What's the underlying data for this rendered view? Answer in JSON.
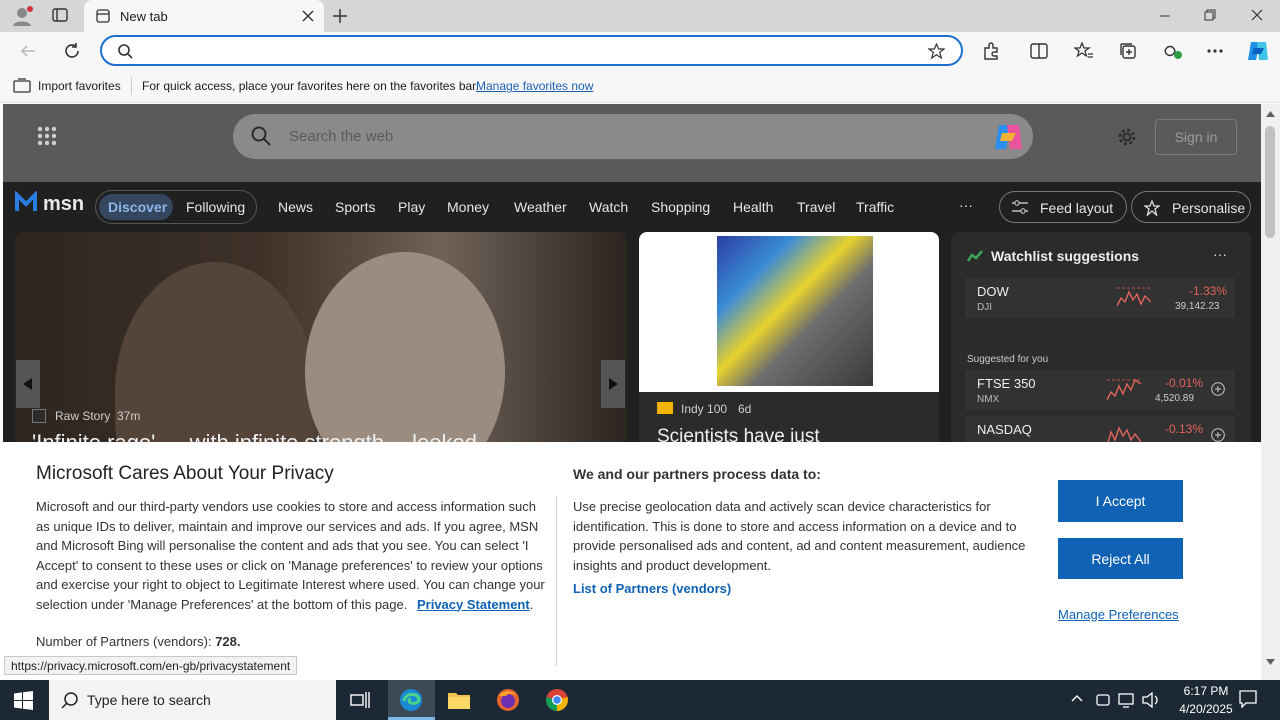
{
  "browser": {
    "tab_title": "New tab",
    "address_value": "",
    "favorites_import": "Import favorites",
    "favorites_hint": "For quick access, place your favorites here on the favorites bar.",
    "favorites_link": "Manage favorites now",
    "status_url": "https://privacy.microsoft.com/en-gb/privacystatement"
  },
  "msn": {
    "search_placeholder": "Search the web",
    "sign_in": "Sign in",
    "logo": "msn",
    "tabs": [
      "Discover",
      "Following"
    ],
    "nav": [
      "News",
      "Sports",
      "Play",
      "Money",
      "Weather",
      "Watch",
      "Shopping",
      "Health",
      "Travel",
      "Traffic"
    ],
    "more": "···",
    "feed_layout": "Feed layout",
    "personalise": "Personalise",
    "hero": {
      "source": "Raw Story",
      "age": "37m",
      "headline": "'Infinite rage' … with infinite strength… looked"
    },
    "story2": {
      "source": "Indy 100",
      "age": "6d",
      "headline": "Scientists have just"
    },
    "watchlist": {
      "title": "Watchlist suggestions",
      "menu": "···",
      "suggested": "Suggested for you",
      "items": [
        {
          "name": "DOW",
          "sub": "DJI",
          "change": "-1.33%",
          "value": "39,142.23"
        },
        {
          "name": "FTSE 350",
          "sub": "NMX",
          "change": "-0.01%",
          "value": "4,520.89"
        },
        {
          "name": "NASDAQ",
          "sub": "",
          "change": "-0.13%",
          "value": ""
        }
      ]
    }
  },
  "privacy": {
    "title": "Microsoft Cares About Your Privacy",
    "body": "Microsoft and our third-party vendors use cookies to store and access information such as unique IDs to deliver, maintain and improve our services and ads. If you agree, MSN and Microsoft Bing will personalise the content and ads that you see. You can select 'I Accept' to consent to these uses or click on 'Manage preferences' to review your options and exercise your right to object to Legitimate Interest where used.  You can change your selection under 'Manage Preferences' at the bottom of this page.",
    "statement_link": "Privacy Statement",
    "partners_label": "Number of Partners (vendors):",
    "partners_count": "728.",
    "process_title": "We and our partners process data to:",
    "process_body": "Use precise geolocation data and actively scan device characteristics for identification. This is done to store and access information on a device and to provide personalised ads and content, ad and content measurement, audience insights and product development.",
    "partners_link": "List of Partners (vendors)",
    "accept": "I Accept",
    "reject": "Reject All",
    "manage": "Manage Preferences"
  },
  "taskbar": {
    "search_placeholder": "Type here to search",
    "time": "6:17 PM",
    "date": "4/20/2025"
  },
  "colors": {
    "accent": "#0f62b4",
    "address_border": "#1e6fd0",
    "negative": "#e0645a"
  }
}
